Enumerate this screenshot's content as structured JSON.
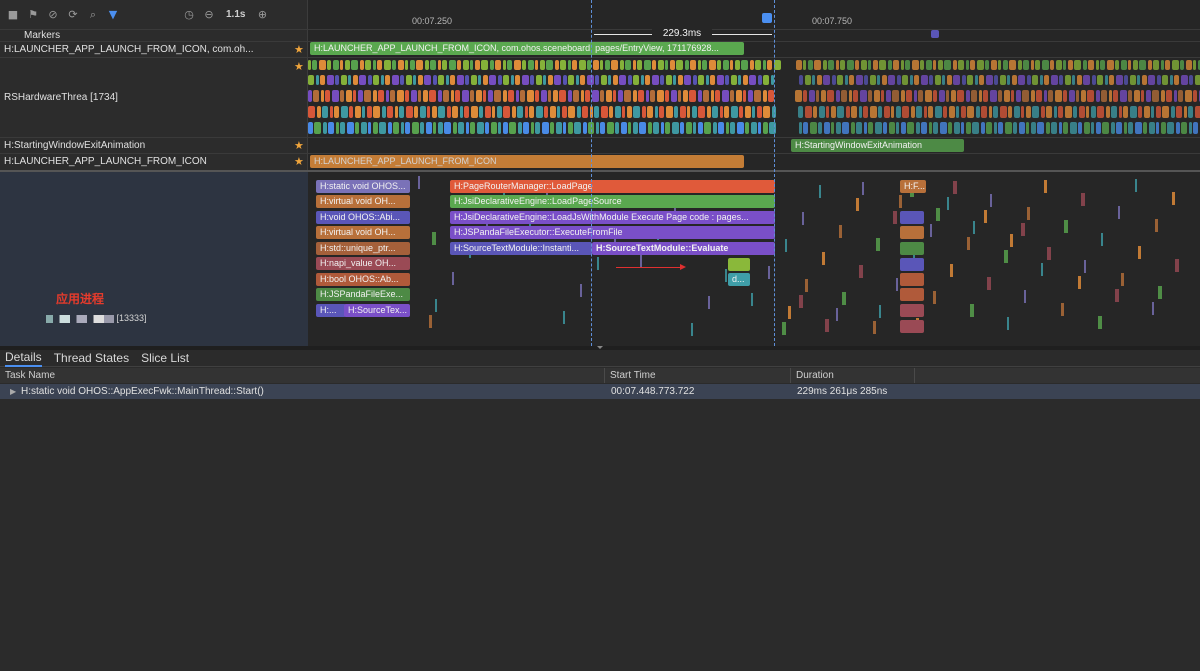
{
  "toolbar": {
    "zoom_label": "1.1s"
  },
  "ruler": {
    "tick1": "00:07.250",
    "tick2": "00:07.750"
  },
  "selection": {
    "range_label": "229.3ms"
  },
  "tracks": {
    "markers": "Markers",
    "launch_marker": "H:LAUNCHER_APP_LAUNCH_FROM_ICON, com.oh...",
    "rs_thread": "RSHardwareThrea [1734]",
    "starting_window": "H:StartingWindowExitAnimation",
    "launch_from_icon": "H:LAUNCHER_APP_LAUNCH_FROM_ICON"
  },
  "slices": {
    "launch_bar": "H:LAUNCHER_APP_LAUNCH_FROM_ICON, com.ohos.sceneboard, pages/EntryView, 171176928...",
    "starting_anim_bar": "H:StartingWindowExitAnimation",
    "launch_icon_bar": "H:LAUNCHER_APP_LAUNCH_FROM_ICON",
    "page_router": "H:PageRouterManager::LoadPage",
    "jsi_load_page_source": "H:JsiDeclarativeEngine::LoadPageSource",
    "jsi_load_js": "H:JsiDeclarativeEngine::LoadJsWithModule Execute Page code : pages...",
    "jspanda_execute": "H:JSPandaFileExecutor::ExecuteFromFile",
    "source_text_inst": "H:SourceTextModule::Instanti...",
    "source_text_eval": "H:SourceTextModule::Evaluate",
    "static_void": "H:static void OHOS...",
    "virtual_void": "H:virtual void OH...",
    "void_ohos": "H:void OHOS::Abi...",
    "virtual_void2": "H:virtual void OH...",
    "std_unique": "H:std::unique_ptr...",
    "napi_value": "H:napi_value OH...",
    "bool_ohos": "H:bool OHOS::Ab...",
    "jspanda_exec2": "H:JSPandaFileExe...",
    "h_short": "H:...",
    "source_tex2": "H:SourceTex...",
    "hf": "H:F...",
    "d_label": "d..."
  },
  "process": {
    "label": "应用进程",
    "name": "[13333]"
  },
  "bottom": {
    "tabs": [
      "Details",
      "Thread States",
      "Slice List"
    ],
    "columns": [
      "Task Name",
      "Start Time",
      "Duration"
    ],
    "row": {
      "task": "H:static void OHOS::AppExecFwk::MainThread::Start()",
      "start": "00:07.448.773.722",
      "duration": "229ms 261μs 285ns"
    }
  },
  "colors": {
    "green": "#5aa84f",
    "orange": "#e8903a",
    "purple": "#7a4fc8",
    "blue_purple": "#5a56b8",
    "red_orange": "#e05a3a",
    "teal": "#3f9ea8",
    "accent_blue": "#4b8ff0"
  }
}
